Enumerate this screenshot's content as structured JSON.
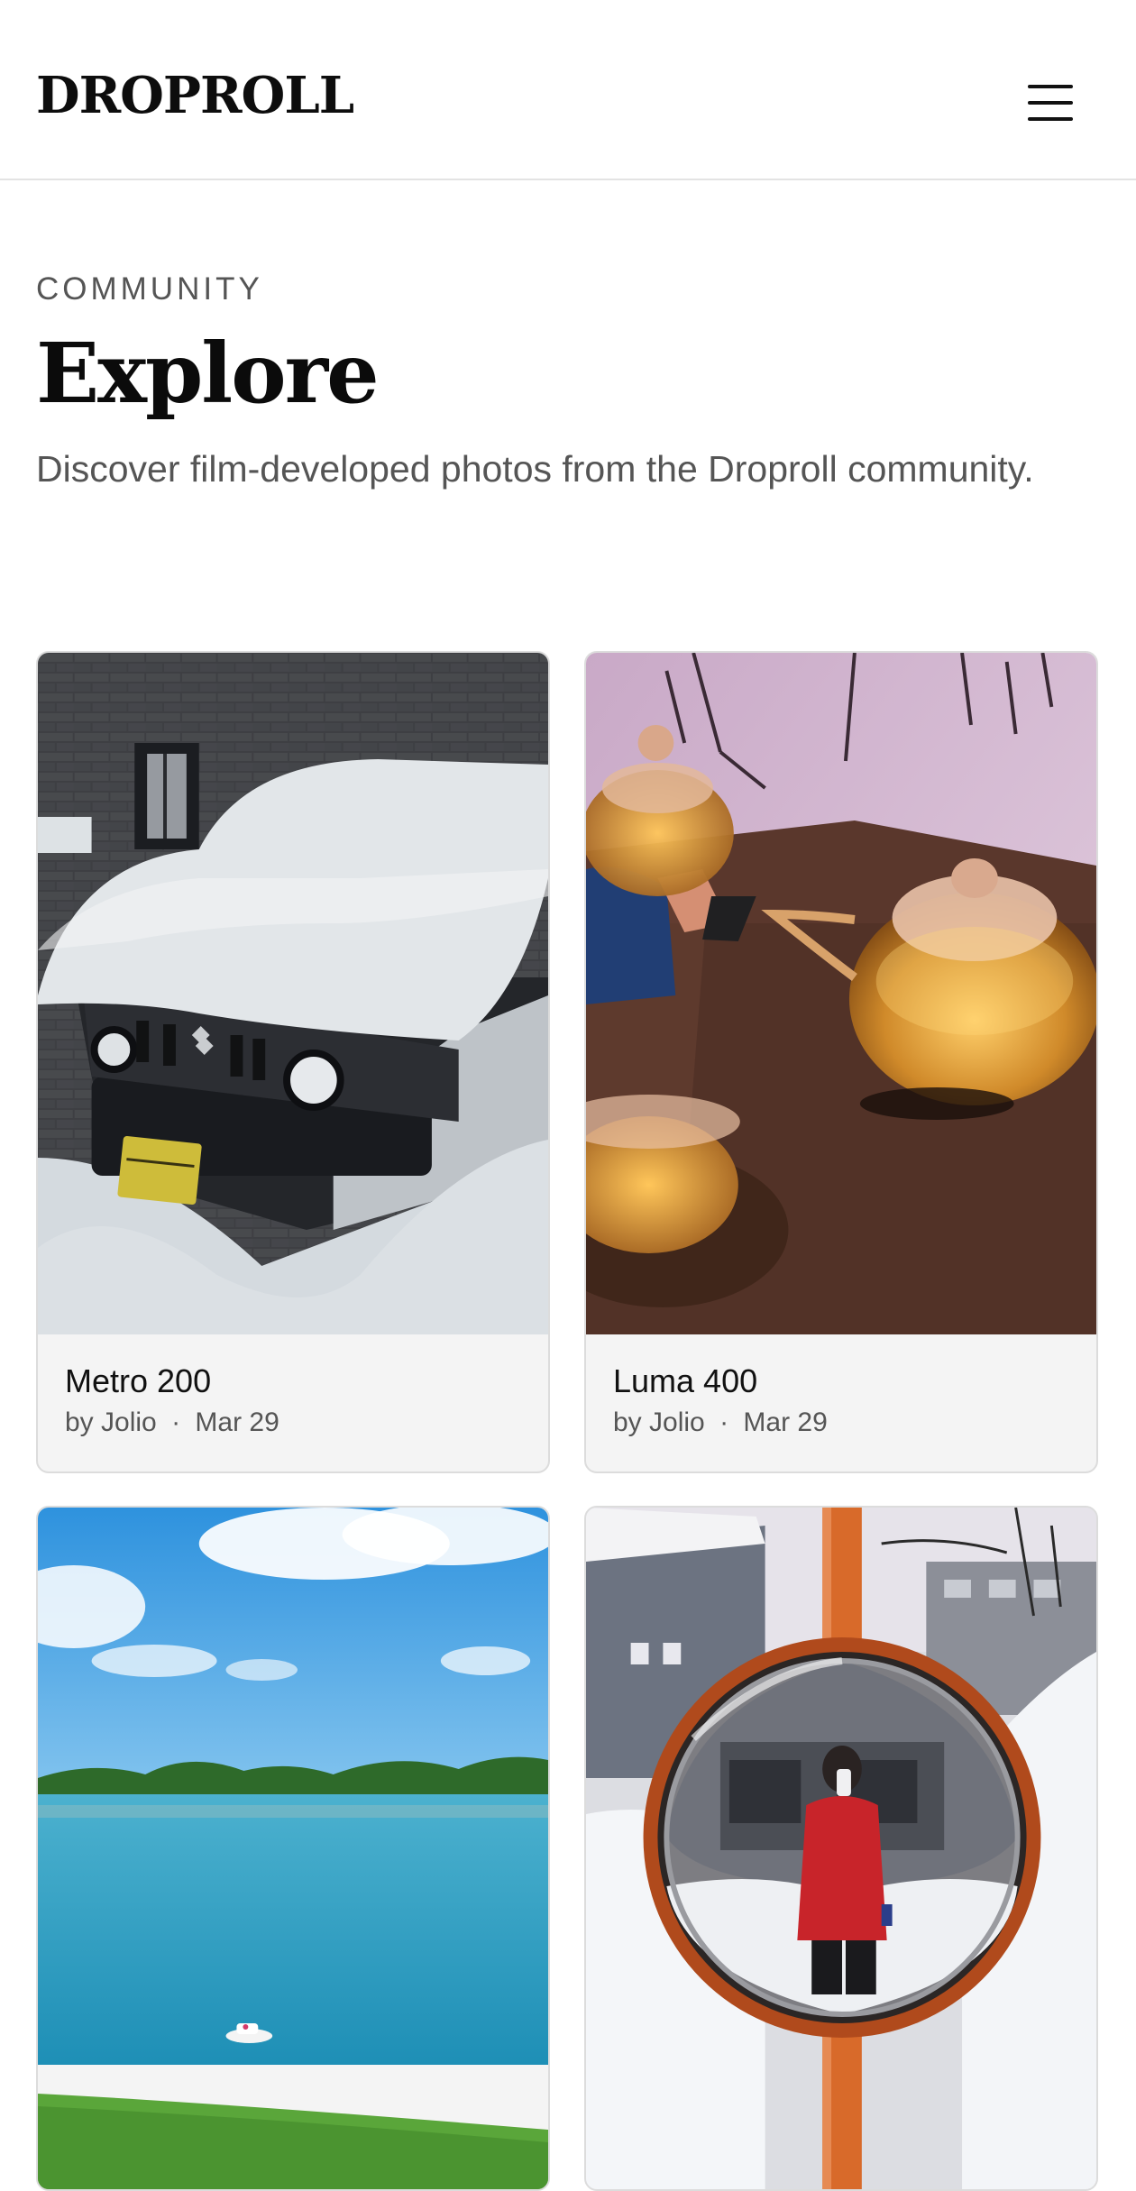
{
  "header": {
    "logo": "DROPROLL",
    "menu_icon": "hamburger-menu-icon"
  },
  "intro": {
    "eyebrow": "COMMUNITY",
    "title": "Explore",
    "subtitle": "Discover film-developed photos from the Droproll community."
  },
  "photos": [
    {
      "title": "Metro 200",
      "author": "by Jolio",
      "separator": "·",
      "date": "Mar 29",
      "scene": "snow-covered white car with yellow plate"
    },
    {
      "title": "Luma 400",
      "author": "by Jolio",
      "separator": "·",
      "date": "Mar 29",
      "scene": "glass teapots with amber tea on a wooden table"
    },
    {
      "title": "",
      "author": "",
      "separator": "",
      "date": "",
      "scene": "lake with small boat under blue sky"
    },
    {
      "title": "",
      "author": "",
      "separator": "",
      "date": "",
      "scene": "person reflected in round orange traffic mirror in snow"
    }
  ],
  "colors": {
    "text_primary": "#111111",
    "text_muted": "#555555",
    "card_bg": "#f4f4f4",
    "card_border": "#dcdcdc",
    "divider": "#e3e3e3"
  }
}
